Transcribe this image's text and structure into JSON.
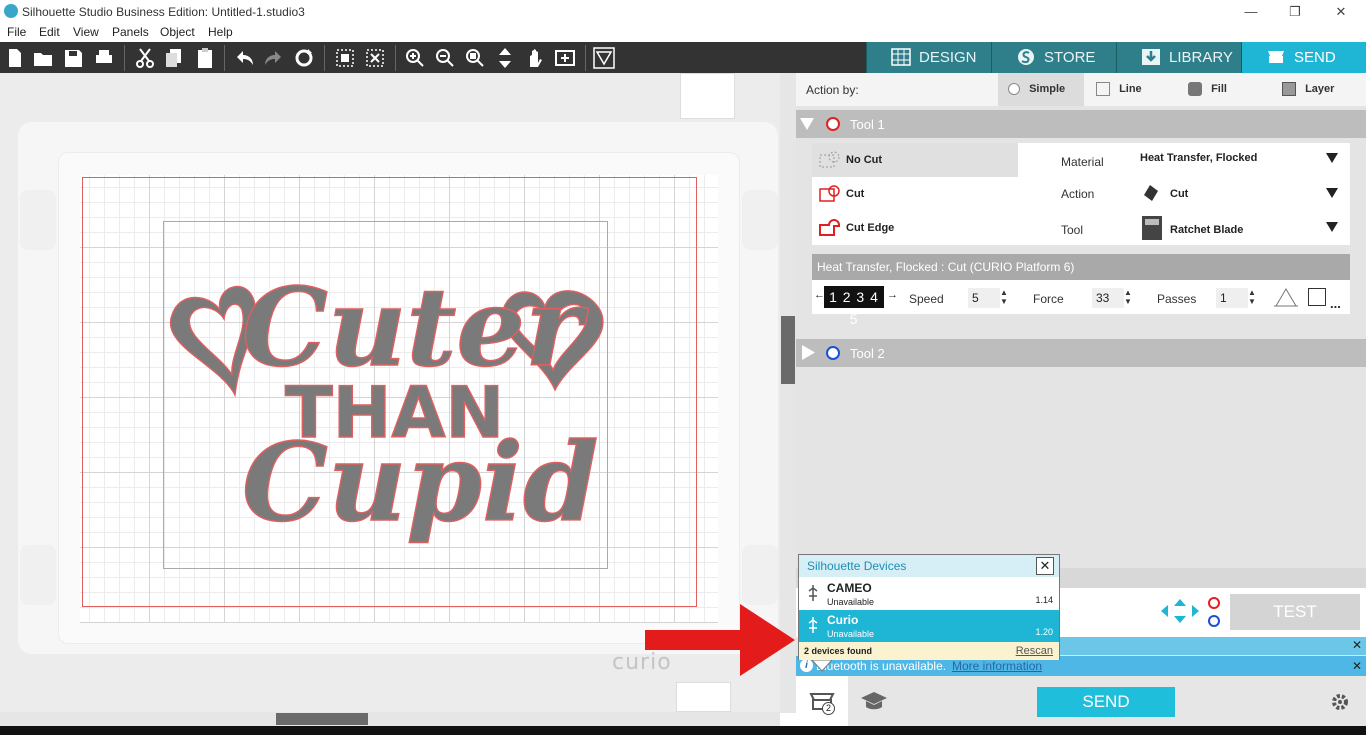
{
  "window": {
    "title": "Silhouette Studio Business Edition: Untitled-1.studio3",
    "controls": {
      "minimize": "—",
      "restore": "❐",
      "close": "✕"
    }
  },
  "menu": [
    "File",
    "Edit",
    "View",
    "Panels",
    "Object",
    "Help"
  ],
  "toolbar_icons": [
    "new-file-icon",
    "open-folder-icon",
    "save-icon",
    "print-icon",
    "cut-icon",
    "copy-icon",
    "paste-icon",
    "undo-icon",
    "redo-icon",
    "redraw-icon",
    "group-icon",
    "ungroup-icon",
    "zoom-in-icon",
    "zoom-out-icon",
    "zoom-select-icon",
    "move-icon",
    "pan-hand-icon",
    "fit-page-icon",
    "pixscan-icon"
  ],
  "tabs": [
    {
      "label": "DESIGN",
      "icon": "grid-icon",
      "active": false
    },
    {
      "label": "STORE",
      "icon": "store-s-icon",
      "active": false
    },
    {
      "label": "LIBRARY",
      "icon": "library-download-icon",
      "active": false
    },
    {
      "label": "SEND",
      "icon": "send-cutter-icon",
      "active": true
    }
  ],
  "canvas": {
    "mat_label": "curio",
    "artwork_text": {
      "line1": "Cuter",
      "line2": "THAN",
      "line3": "Cupid"
    }
  },
  "send_panel": {
    "action_by_label": "Action by:",
    "modes": [
      "Simple",
      "Line",
      "Fill",
      "Layer"
    ],
    "selected_mode": "Simple",
    "tool1": {
      "label": "Tool 1",
      "color": "#e02020",
      "cut_options": [
        "No Cut",
        "Cut",
        "Cut Edge"
      ],
      "selected_cut_option": "No Cut",
      "material_label": "Material",
      "material_value": "Heat Transfer, Flocked",
      "action_label": "Action",
      "action_value": "Cut",
      "tool_label": "Tool",
      "tool_value": "Ratchet Blade",
      "summary": "Heat Transfer, Flocked : Cut (CURIO Platform 6)",
      "blade_digits": "1 2 3 4 5",
      "speed_label": "Speed",
      "speed_value": "5",
      "force_label": "Force",
      "force_value": "33",
      "passes_label": "Passes",
      "passes_value": "1",
      "more": "..."
    },
    "tool2": {
      "label": "Tool 2",
      "color": "#1a4fd8"
    },
    "test_label": "TEST",
    "send_label": "SEND"
  },
  "devices_popup": {
    "title": "Silhouette Devices",
    "close": "✕",
    "devices": [
      {
        "name": "CAMEO",
        "status": "Unavailable",
        "version": "1.14",
        "selected": false
      },
      {
        "name": "Curio",
        "status": "Unavailable",
        "version": "1.20",
        "selected": true
      }
    ],
    "found_text": "2 devices found",
    "rescan_label": "Rescan"
  },
  "notifications": {
    "bluetooth_text": "Bluetooth is unavailable.",
    "more_info": "More information",
    "close": "✕"
  },
  "device_badge": "2",
  "colors": {
    "accent": "#1fb6d6",
    "tab_inactive": "#2f7f8a",
    "toolbar": "#333333",
    "artwork": "#7a7a7a",
    "cut_line": "#e06060"
  }
}
